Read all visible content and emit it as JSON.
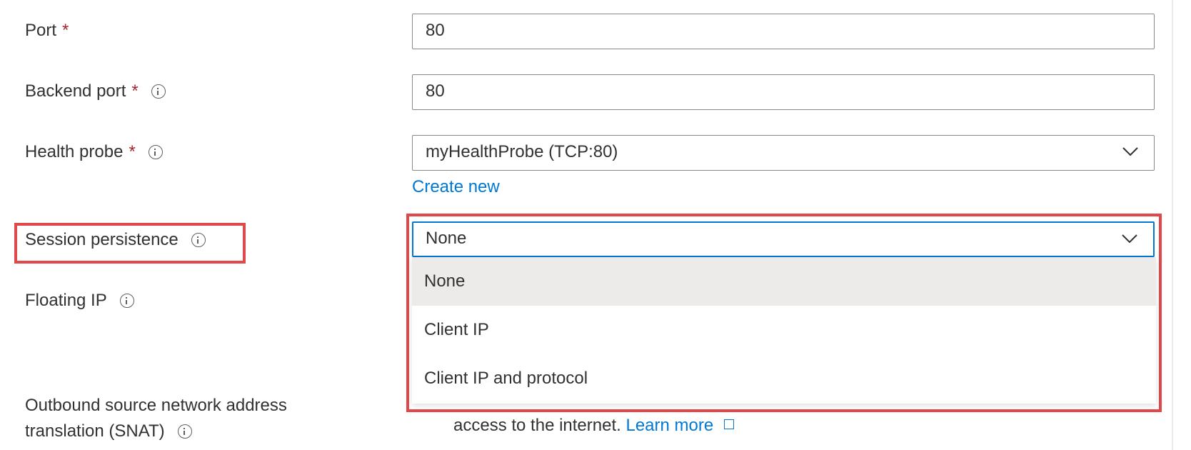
{
  "fields": {
    "port": {
      "label": "Port",
      "required": "*",
      "value": "80"
    },
    "backend_port": {
      "label": "Backend port",
      "required": "*",
      "value": "80"
    },
    "health_probe": {
      "label": "Health probe",
      "required": "*",
      "value": "myHealthProbe (TCP:80)",
      "create_new": "Create new"
    },
    "session_persistence": {
      "label": "Session persistence",
      "value": "None",
      "options": [
        "None",
        "Client IP",
        "Client IP and protocol"
      ],
      "selected_index": 0
    },
    "floating_ip": {
      "label": "Floating IP"
    },
    "snat": {
      "label_line1": "Outbound source network address",
      "label_line2": "translation (SNAT)",
      "info_text": "access to the internet.",
      "learn_more": "Learn more"
    }
  },
  "icons": [
    "info-icon",
    "chevron-down-icon",
    "external-link-icon"
  ],
  "colors": {
    "accent": "#0078d4",
    "required": "#a4262c",
    "highlight": "#e0484a",
    "selected_option_bg": "#edebe9"
  }
}
